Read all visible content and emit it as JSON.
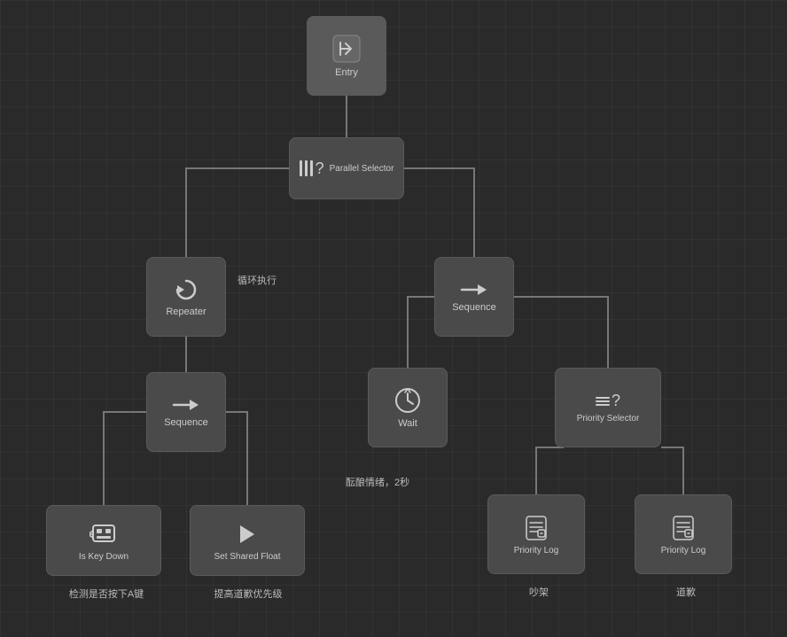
{
  "nodes": {
    "entry": {
      "label": "Entry"
    },
    "parallel_selector": {
      "label": "Parallel Selector"
    },
    "repeater": {
      "label": "Repeater"
    },
    "sequence_left": {
      "label": "Sequence"
    },
    "sequence_right": {
      "label": "Sequence"
    },
    "wait": {
      "label": "Wait"
    },
    "priority_selector": {
      "label": "Priority Selector"
    },
    "key_down": {
      "label": "Is Key Down"
    },
    "set_float": {
      "label": "Set Shared Float"
    },
    "priority_log_left": {
      "label": "Priority Log"
    },
    "priority_log_right": {
      "label": "Priority Log"
    }
  },
  "annotations": {
    "loop": "循环执行",
    "wait_desc": "酝酿情绪，2秒",
    "keydown_desc": "检测是否按下A键",
    "setfloat_desc": "提高道歉优先级",
    "log_brawl": "吵架",
    "log_apology": "道歉"
  }
}
